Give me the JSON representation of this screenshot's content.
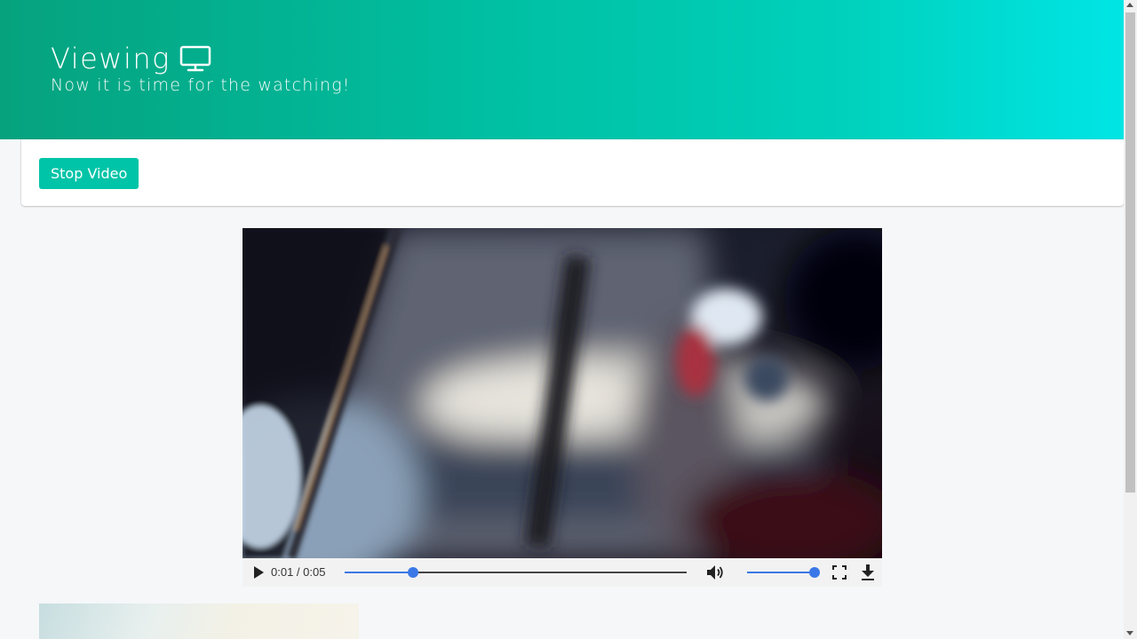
{
  "hero": {
    "title": "Viewing",
    "title_icon": "monitor-icon",
    "subtitle": "Now it is time for the watching!",
    "gradient": [
      "#06a27e",
      "#00e5e5"
    ]
  },
  "toolbar": {
    "stop_label": "Stop Video",
    "accent": "#00c4a7"
  },
  "player": {
    "time_display": "0:01 / 0:05",
    "progress_fraction": 0.2,
    "volume_fraction": 1.0,
    "icons": [
      "play-icon",
      "volume-icon",
      "fullscreen-icon",
      "download-icon"
    ],
    "control_accent": "#3b78e7"
  }
}
